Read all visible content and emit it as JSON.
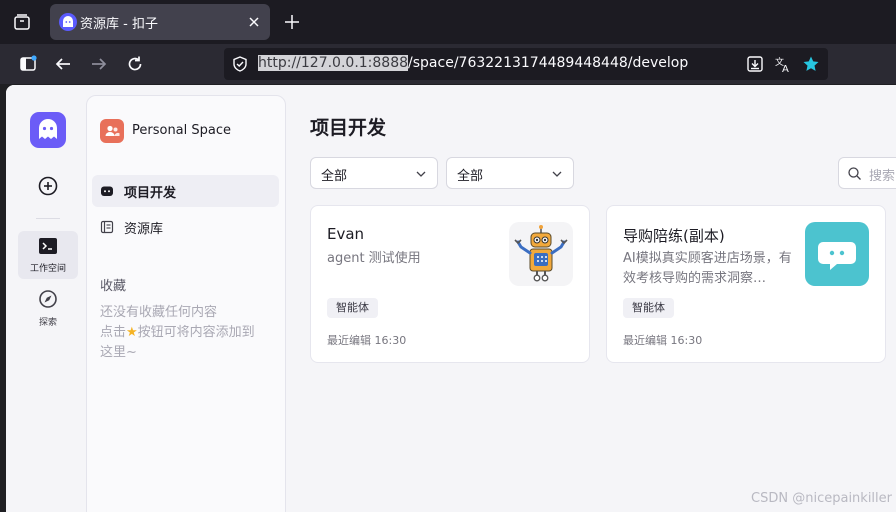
{
  "browser": {
    "tab_title": "资源库 - 扣子",
    "url_host": "http://127.0.0.1:8888",
    "url_path": "/space/7632213174489448448/develop"
  },
  "rail": {
    "workspace_label": "工作空间",
    "explore_label": "探索"
  },
  "panel": {
    "space_name": "Personal Space",
    "menu": [
      {
        "label": "项目开发",
        "icon": "bot-icon",
        "active": true
      },
      {
        "label": "资源库",
        "icon": "library-icon",
        "active": false
      }
    ],
    "favorites_title": "收藏",
    "favorites_empty_line1": "还没有收藏任何内容",
    "favorites_empty_line2_prefix": "点击",
    "favorites_empty_line2_suffix": "按钮可将内容添加到",
    "favorites_empty_line3": "这里~"
  },
  "main": {
    "title": "项目开发",
    "filter_type": "全部",
    "filter_status": "全部",
    "search_placeholder": "搜索",
    "cards": [
      {
        "title": "Evan",
        "desc": "agent 测试使用",
        "tag": "智能体",
        "edited": "最近编辑 16:30",
        "thumb": "robot-icon"
      },
      {
        "title": "导购陪练(副本)",
        "desc": "AI模拟真实顾客进店场景，有效考核导购的需求洞察…",
        "tag": "智能体",
        "edited": "最近编辑 16:30",
        "thumb": "chat-bubble-icon"
      }
    ]
  },
  "watermark": "CSDN @nicepainkiller",
  "colors": {
    "brand": "#6b5cf7",
    "space_avatar": "#e8705a",
    "chat_thumb": "#4cc3cf"
  }
}
